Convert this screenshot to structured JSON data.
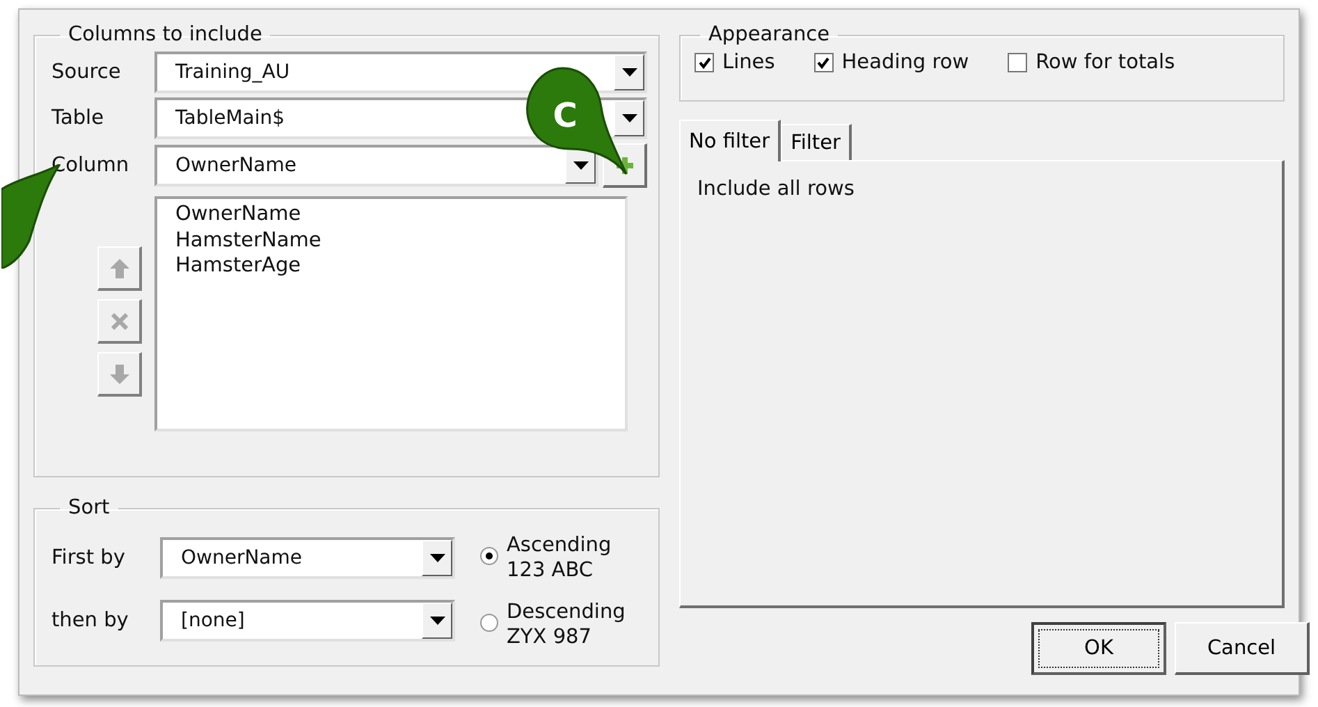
{
  "columns_group": {
    "title": "Columns to include",
    "selectors": [
      {
        "label": "Source",
        "value": "Training_AU",
        "kind": "combo"
      },
      {
        "label": "Table",
        "value": "TableMain$",
        "kind": "combo"
      },
      {
        "label": "Column",
        "value": "OwnerName",
        "kind": "combo-add"
      }
    ],
    "list": [
      "OwnerName",
      "HamsterName",
      "HamsterAge"
    ]
  },
  "sort_group": {
    "title": "Sort",
    "selectors": [
      {
        "label": "First by",
        "value": "OwnerName"
      },
      {
        "label": "then by",
        "value": "[none]"
      }
    ],
    "order": [
      {
        "label": "Ascending",
        "sublabel": "123 ABC",
        "selected": true
      },
      {
        "label": "Descending",
        "sublabel": "ZYX 987",
        "selected": false
      }
    ]
  },
  "appearance": {
    "title": "Appearance",
    "options": [
      {
        "label": "Lines",
        "checked": true
      },
      {
        "label": "Heading row",
        "checked": true
      },
      {
        "label": "Row for totals",
        "checked": false
      }
    ]
  },
  "tabs": [
    {
      "label": "No filter",
      "selected": true
    },
    {
      "label": "Filter",
      "selected": false
    }
  ],
  "tab_content": "Include all rows",
  "buttons": [
    {
      "label": "OK",
      "default": true
    },
    {
      "label": "Cancel",
      "default": false
    }
  ],
  "callouts": [
    {
      "label": "C"
    }
  ]
}
